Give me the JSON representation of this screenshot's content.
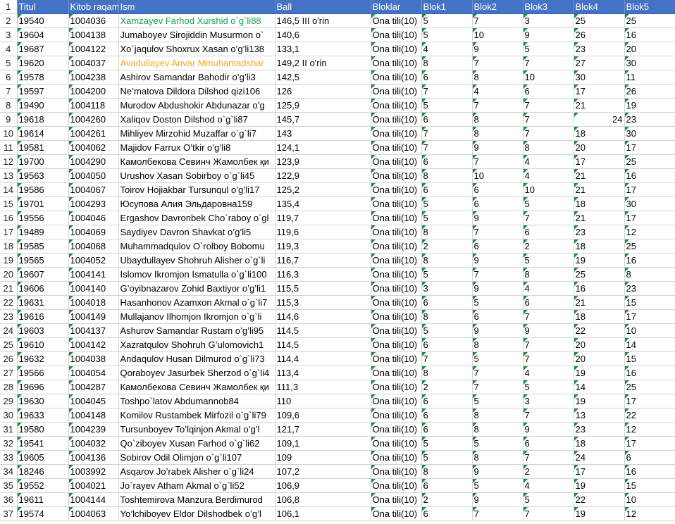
{
  "sheet": {
    "headers": [
      "Titul",
      "Kitob raqam",
      "Ism",
      "Ball",
      "Bloklar",
      "Blok1",
      "Blok2",
      "Blok3",
      "Blok4",
      "Blok5"
    ],
    "rows": [
      {
        "rn": "2",
        "c": [
          "19540",
          "1004036",
          "Xamzayev Farhod Xurshid  o`g`li88",
          "146,5  III o'rin",
          "Ona tili(10)",
          "5",
          "7",
          "3",
          "25",
          "25"
        ],
        "color": "green"
      },
      {
        "rn": "3",
        "c": [
          "19604",
          "1004138",
          "Jumaboyev Sirojiddin Musurmon o`",
          "140,6",
          "Ona tili(10)",
          "5",
          "10",
          "9",
          "26",
          "16"
        ]
      },
      {
        "rn": "4",
        "c": [
          "19687",
          "1004122",
          "Xo`jaqulov Shoxrux Xasan o’g’li138",
          "133,1",
          "Ona tili(10)",
          "4",
          "9",
          "5",
          "23",
          "20"
        ]
      },
      {
        "rn": "5",
        "c": [
          "19620",
          "1004037",
          "Avadullayev Anvar Mmuhamadshar",
          "149,2  II o'rin",
          "Ona tili(10)",
          "8",
          "7",
          "7",
          "27",
          "30"
        ],
        "color": "orange"
      },
      {
        "rn": "6",
        "c": [
          "19578",
          "1004238",
          "Ashirov Samandar Bahodir o’g’li3",
          "142,5",
          "Ona tili(10)",
          "6",
          "8",
          "10",
          "30",
          "11"
        ]
      },
      {
        "rn": "7",
        "c": [
          "19597",
          "1004200",
          "Ne’matova Dildora Dilshod qizi106",
          "126",
          "Ona tili(10)",
          "7",
          "4",
          "6",
          "17",
          "26"
        ]
      },
      {
        "rn": "8",
        "c": [
          "19490",
          "1004118",
          "Murodov Abdushokir Abdunazar o’g",
          "125,9",
          "Ona tili(10)",
          "5",
          "7",
          "7",
          "21",
          "19"
        ]
      },
      {
        "rn": "9",
        "c": [
          "19618",
          "1004260",
          "Xaliqov Doston Dilshod  o`g`li87",
          "145,7",
          "Ona tili(10)",
          "6",
          "8",
          "7",
          "24",
          "23"
        ],
        "b4right": true
      },
      {
        "rn": "10",
        "c": [
          "19614",
          "1004261",
          "Mihliyev Mirzohid Muzaffar  o`g`li7",
          "143",
          "Ona tili(10)",
          "7",
          "8",
          "7",
          "18",
          "30"
        ]
      },
      {
        "rn": "11",
        "c": [
          "19581",
          "1004062",
          "Majidov Farrux O’tkir o’g’li8",
          "124,1",
          "Ona tili(10)",
          "7",
          "9",
          "8",
          "20",
          "17"
        ]
      },
      {
        "rn": "12",
        "c": [
          "19700",
          "1004290",
          "Камолбекова Севинч Жамолбек қи",
          "123,9",
          "Ona tili(10)",
          "6",
          "7",
          "4",
          "17",
          "25"
        ]
      },
      {
        "rn": "13",
        "c": [
          "19563",
          "1004050",
          "Urushov Xasan Sobirboy  o`g`li45",
          "122,9",
          "Ona tili(10)",
          "8",
          "10",
          "4",
          "21",
          "16"
        ]
      },
      {
        "rn": "14",
        "c": [
          "19586",
          "1004067",
          "Toirov Hojiakbar Tursunqul o’g’li17",
          "125,2",
          "Ona tili(10)",
          "6",
          "6",
          "10",
          "21",
          "17"
        ]
      },
      {
        "rn": "15",
        "c": [
          "19701",
          "1004293",
          "Юсупова Алия Эльдаровна159",
          "135,4",
          "Ona tili(10)",
          "5",
          "6",
          "5",
          "18",
          "30"
        ]
      },
      {
        "rn": "16",
        "c": [
          "19556",
          "1004046",
          "Ergashov Davronbek Cho`raboy o`gl",
          "119,7",
          "Ona tili(10)",
          "5",
          "9",
          "7",
          "21",
          "17"
        ]
      },
      {
        "rn": "17",
        "c": [
          "19489",
          "1004069",
          "Saydiyev Davron Shavkat o’g’li5",
          "119,6",
          "Ona tili(10)",
          "8",
          "7",
          "6",
          "23",
          "12"
        ]
      },
      {
        "rn": "18",
        "c": [
          "19585",
          "1004068",
          "Muhammadqulov O`rolboy Bobomu",
          "119,3",
          "Ona tili(10)",
          "2",
          "6",
          "2",
          "18",
          "25"
        ]
      },
      {
        "rn": "19",
        "c": [
          "19565",
          "1004052",
          "Ubaydullayev Shohruh Alisher  o`g`li",
          "116,7",
          "Ona tili(10)",
          "8",
          "9",
          "5",
          "19",
          "16"
        ]
      },
      {
        "rn": "20",
        "c": [
          "19607",
          "1004141",
          "Islomov Ikromjon Ismatulla  o`g`li100",
          "116,3",
          "Ona tili(10)",
          "5",
          "7",
          "8",
          "25",
          "8"
        ]
      },
      {
        "rn": "21",
        "c": [
          "19606",
          "1004140",
          "G’oyibnazarov Zohid Baxtiyor  o’g’li1",
          "115,5",
          "Ona tili(10)",
          "3",
          "9",
          "4",
          "16",
          "23"
        ]
      },
      {
        "rn": "22",
        "c": [
          "19631",
          "1004018",
          "Hasanhonov Azamxon Akmal o`g`li7",
          "115,3",
          "Ona tili(10)",
          "6",
          "5",
          "6",
          "21",
          "15"
        ]
      },
      {
        "rn": "23",
        "c": [
          "19616",
          "1004149",
          "Mullajanov Ilhomjon Ikromjon  o`g`li",
          "114,6",
          "Ona tili(10)",
          "8",
          "6",
          "7",
          "18",
          "17"
        ]
      },
      {
        "rn": "24",
        "c": [
          "19603",
          "1004137",
          "Ashurov Samandar Rustam o’g’li95",
          "114,5",
          "Ona tili(10)",
          "5",
          "9",
          "9",
          "22",
          "10"
        ]
      },
      {
        "rn": "25",
        "c": [
          "19610",
          "1004142",
          "Xazratqulov Shohruh G’ulomovich1",
          "114,5",
          "Ona tili(10)",
          "6",
          "8",
          "7",
          "20",
          "14"
        ]
      },
      {
        "rn": "26",
        "c": [
          "19632",
          "1004038",
          "Andaqulov Husan Dilmurod  o`g`li73",
          "114,4",
          "Ona tili(10)",
          "7",
          "5",
          "7",
          "20",
          "15"
        ]
      },
      {
        "rn": "27",
        "c": [
          "19566",
          "1004054",
          "Qoraboyev Jasurbek Sherzod o`g`li4",
          "113,4",
          "Ona tili(10)",
          "8",
          "7",
          "4",
          "19",
          "16"
        ]
      },
      {
        "rn": "28",
        "c": [
          "19696",
          "1004287",
          "Камолбекова Севинч Жамолбек қи",
          "111,3",
          "Ona tili(10)",
          "2",
          "7",
          "5",
          "14",
          "25"
        ]
      },
      {
        "rn": "29",
        "c": [
          "19630",
          "1004045",
          "Toshpo`latov Abdumannob84",
          "110",
          "Ona tili(10)",
          "6",
          "5",
          "3",
          "19",
          "17"
        ]
      },
      {
        "rn": "30",
        "c": [
          "19633",
          "1004148",
          "Komilov Rustambek Mirfozil o`g`li79",
          "109,6",
          "Ona tili(10)",
          "6",
          "8",
          "7",
          "13",
          "22"
        ]
      },
      {
        "rn": "31",
        "c": [
          "19580",
          "1004239",
          "Tursunboyev To’lqinjon Akmal o’g’l",
          "121,7",
          "Ona tili(10)",
          "6",
          "8",
          "9",
          "23",
          "12"
        ]
      },
      {
        "rn": "32",
        "c": [
          "19541",
          "1004032",
          "Qo`ziboyev Xusan Farhod o`g`li62",
          "109,1",
          "Ona tili(10)",
          "5",
          "5",
          "6",
          "18",
          "17"
        ]
      },
      {
        "rn": "33",
        "c": [
          "19605",
          "1004136",
          "Sobirov Odil Olimjon o`g`li107",
          "109",
          "Ona tili(10)",
          "5",
          "8",
          "7",
          "24",
          "6"
        ]
      },
      {
        "rn": "34",
        "c": [
          "18246",
          "1003992",
          "  Asqarov Jo’rabek Alisher o`g`li24",
          "107,2",
          "Ona tili(10)",
          "8",
          "9",
          "2",
          "17",
          "16"
        ]
      },
      {
        "rn": "35",
        "c": [
          "19552",
          "1004021",
          "Jo`rayev Atham Akmal o`g`li52",
          "106,9",
          "Ona tili(10)",
          "6",
          "5",
          "4",
          "19",
          "15"
        ]
      },
      {
        "rn": "36",
        "c": [
          "19611",
          "1004144",
          "Toshtemirova Manzura Berdimurod",
          "106,8",
          "Ona tili(10)",
          "2",
          "9",
          "5",
          "22",
          "10"
        ]
      },
      {
        "rn": "37",
        "c": [
          "19574",
          "1004063",
          "Yo’lchiboyev Eldor Dilshodbek o’g’l",
          "106,1",
          "Ona tili(10)",
          "6",
          "7",
          "7",
          "19",
          "12"
        ]
      }
    ]
  }
}
